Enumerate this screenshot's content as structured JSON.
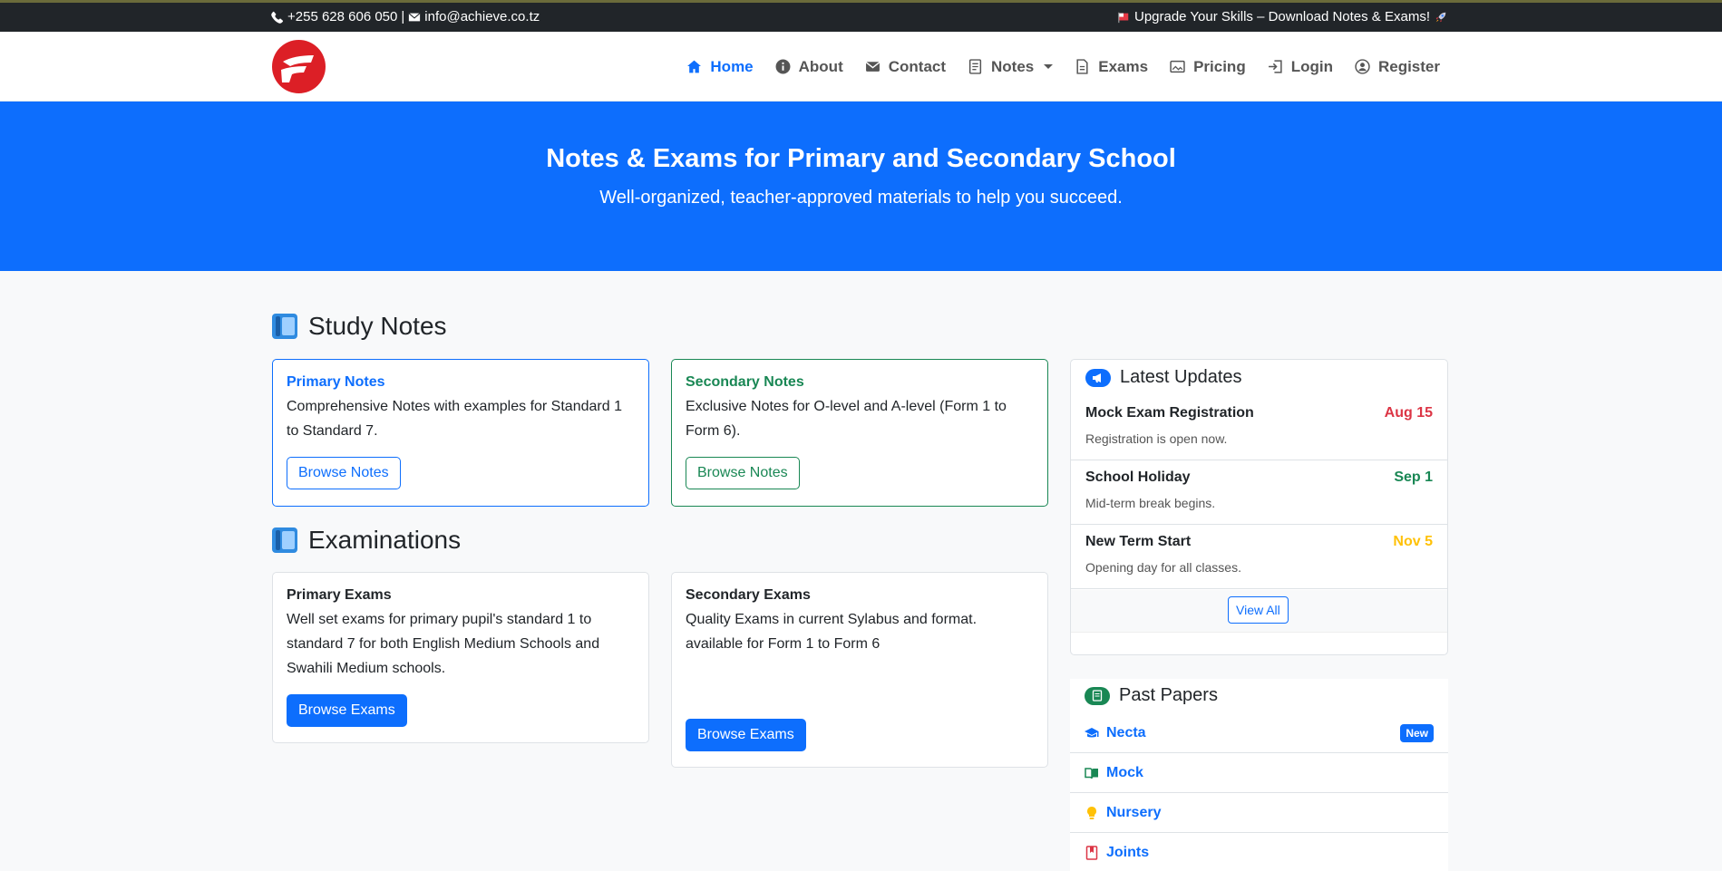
{
  "topbar": {
    "phone": "+255 628 606 050",
    "separator": "|",
    "email": "info@achieve.co.tz",
    "promo": "Upgrade Your Skills – Download Notes & Exams!"
  },
  "nav": {
    "items": [
      {
        "label": "Home",
        "icon": "home-icon",
        "active": true
      },
      {
        "label": "About",
        "icon": "info-icon"
      },
      {
        "label": "Contact",
        "icon": "envelope-icon"
      },
      {
        "label": "Notes",
        "icon": "document-icon",
        "dropdown": true
      },
      {
        "label": "Exams",
        "icon": "file-icon"
      },
      {
        "label": "Pricing",
        "icon": "image-icon"
      },
      {
        "label": "Login",
        "icon": "login-icon"
      },
      {
        "label": "Register",
        "icon": "user-circle-icon"
      }
    ]
  },
  "hero": {
    "title": "Notes & Exams for Primary and Secondary School",
    "subtitle": "Well-organized, teacher-approved materials to help you succeed."
  },
  "notes_section": {
    "title": "Study Notes",
    "cards": [
      {
        "title": "Primary Notes",
        "text": "Comprehensive Notes with examples for Standard 1 to Standard 7.",
        "button": "Browse Notes"
      },
      {
        "title": "Secondary Notes",
        "text": "Exclusive Notes for O-level and A-level (Form 1 to Form 6).",
        "button": "Browse Notes"
      }
    ]
  },
  "exams_section": {
    "title": "Examinations",
    "cards": [
      {
        "title": "Primary Exams",
        "text": "Well set exams for primary pupil's standard 1 to standard 7 for both English Medium Schools and Swahili Medium schools.",
        "button": "Browse Exams"
      },
      {
        "title": "Secondary Exams",
        "text": "Quality Exams in current Sylabus and format. available for Form 1 to Form 6",
        "button": "Browse Exams"
      }
    ]
  },
  "updates": {
    "title": "Latest Updates",
    "items": [
      {
        "title": "Mock Exam Registration",
        "date": "Aug 15",
        "desc": "Registration is open now.",
        "color": "#dc3545"
      },
      {
        "title": "School Holiday",
        "date": "Sep 1",
        "desc": "Mid-term break begins.",
        "color": "#198754"
      },
      {
        "title": "New Term Start",
        "date": "Nov 5",
        "desc": "Opening day for all classes.",
        "color": "#ffc107"
      }
    ],
    "view_all": "View All"
  },
  "past_papers": {
    "title": "Past Papers",
    "items": [
      {
        "label": "Necta",
        "icon": "graduation-cap-icon",
        "badge": "New"
      },
      {
        "label": "Mock",
        "icon": "open-book-icon"
      },
      {
        "label": "Nursery",
        "icon": "lightbulb-icon"
      },
      {
        "label": "Joints",
        "icon": "journal-icon"
      }
    ]
  },
  "colors": {
    "primary": "#0d6efd",
    "success": "#198754",
    "danger": "#dc3545",
    "warning": "#ffc107",
    "dark": "#212529"
  }
}
